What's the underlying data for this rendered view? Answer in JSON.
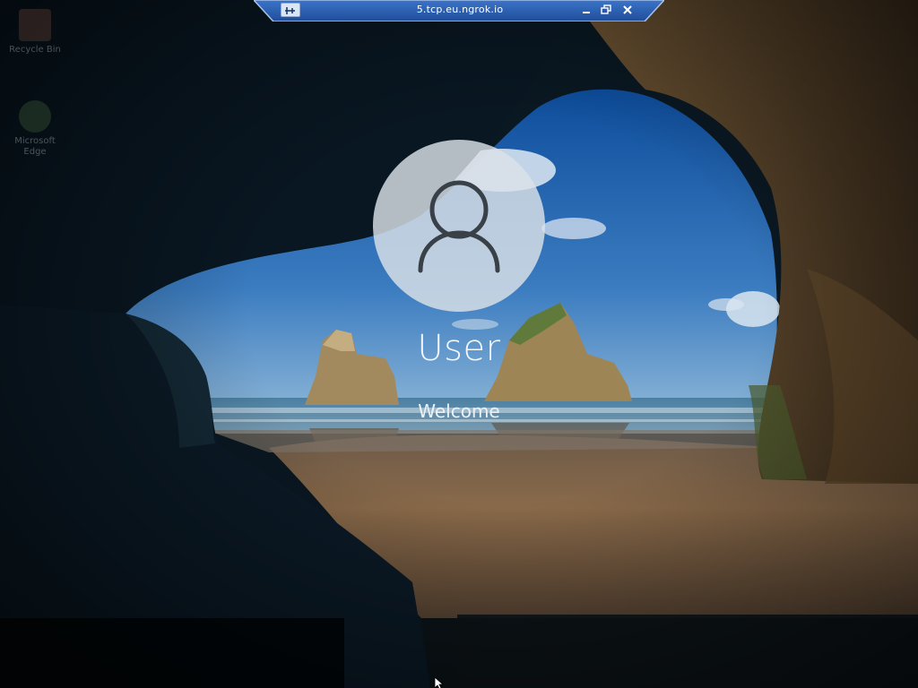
{
  "remote_session": {
    "title": "5.tcp.eu.ngrok.io",
    "pin_icon": "pin-icon",
    "minimize_icon": "minimize-icon",
    "restore_icon": "restore-icon",
    "close_icon": "close-icon"
  },
  "desktop": {
    "icons": [
      {
        "label": "Recycle Bin",
        "icon": "recycle-bin-icon"
      },
      {
        "label": "Microsoft Edge",
        "icon": "edge-icon"
      }
    ]
  },
  "lock_screen": {
    "user_name": "User",
    "status": "Welcome",
    "avatar_icon": "user-avatar-icon"
  },
  "colors": {
    "bar": "#2a5aa8",
    "bar_border": "#9cb8e6",
    "avatar_bg": "#dce2e8",
    "text": "#f4f7fa",
    "sky": "#2a6db4",
    "sand": "#8a6a48",
    "cave": "#0a1a26"
  }
}
